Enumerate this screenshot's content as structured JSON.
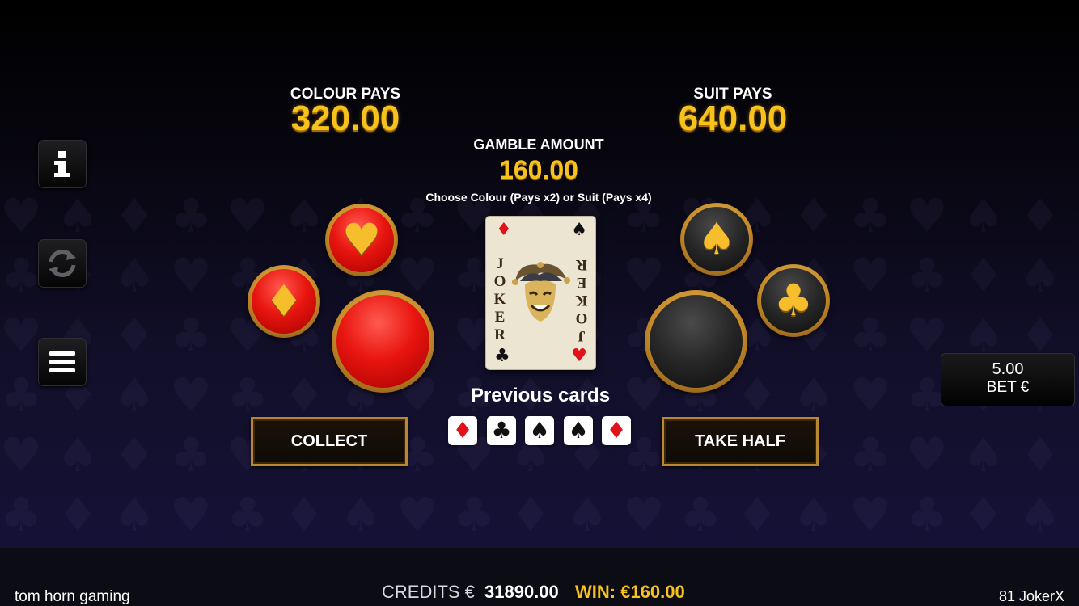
{
  "pays": {
    "colour_label": "COLOUR PAYS",
    "colour_value": "320.00",
    "suit_label": "SUIT PAYS",
    "suit_value": "640.00"
  },
  "gamble": {
    "label": "GAMBLE AMOUNT",
    "value": "160.00",
    "instruction": "Choose Colour (Pays x2) or Suit (Pays x4)"
  },
  "card": {
    "left_text": "JOKER",
    "right_text": "JOKER",
    "corner_suits": [
      "diamond",
      "spade",
      "club",
      "heart"
    ]
  },
  "previous": {
    "title": "Previous cards",
    "cards": [
      {
        "suit": "diamond",
        "glyph": "♦",
        "color": "#e3111a"
      },
      {
        "suit": "club",
        "glyph": "♣",
        "color": "#111111"
      },
      {
        "suit": "spade",
        "glyph": "♠",
        "color": "#111111"
      },
      {
        "suit": "spade",
        "glyph": "♠",
        "color": "#111111"
      },
      {
        "suit": "diamond",
        "glyph": "♦",
        "color": "#e3111a"
      }
    ]
  },
  "buttons": {
    "collect": "COLLECT",
    "take_half": "TAKE HALF",
    "suit_icons": {
      "heart": "heart-icon",
      "diamond": "diamond-icon",
      "spade": "spade-icon",
      "club": "club-icon"
    }
  },
  "side_menu": {
    "info_icon": "info-icon",
    "autoplay_icon": "refresh-icon",
    "menu_icon": "hamburger-menu-icon"
  },
  "bet": {
    "value": "5.00",
    "label": "BET €"
  },
  "footer": {
    "brand": "tom horn gaming",
    "credits_label": "CREDITS €",
    "credits_value": "31890.00",
    "win_label": "WIN: €160.00",
    "game_name": "81 JokerX"
  },
  "colors": {
    "gold": "#f7c21b",
    "red": "#e8150f",
    "black": "#262626"
  }
}
